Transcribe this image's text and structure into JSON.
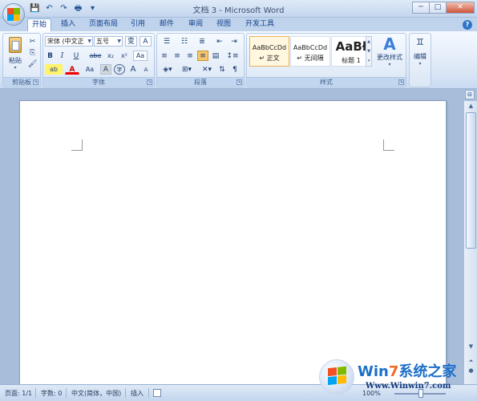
{
  "window": {
    "title": "文档 3 - Microsoft Word",
    "controls": {
      "minimize": "─",
      "maximize": "□",
      "close": "✕"
    }
  },
  "qat": {
    "save": "💾",
    "undo": "↶",
    "redo": "↷",
    "print": "🖶",
    "customize": "▾"
  },
  "tabs": [
    "开始",
    "插入",
    "页面布局",
    "引用",
    "邮件",
    "审阅",
    "视图",
    "开发工具"
  ],
  "active_tab": "开始",
  "help": "?",
  "ribbon": {
    "clipboard": {
      "label": "剪贴板",
      "paste": "粘贴",
      "cut": "✂",
      "copy": "⎘",
      "format_painter": "🖌"
    },
    "font": {
      "label": "字体",
      "font_name": "宋体 (中文正",
      "font_size": "五号",
      "wen": "变",
      "clear": "A",
      "bold": "B",
      "italic": "I",
      "underline": "U",
      "strikethrough": "abe",
      "subscript": "x₂",
      "superscript": "x²",
      "clear_format": "Aa",
      "highlight": "ab",
      "font_color": "A",
      "case": "Aa",
      "char_shading": "A",
      "enclose": "字",
      "grow": "A",
      "shrink": "A"
    },
    "paragraph": {
      "label": "段落"
    },
    "styles": {
      "label": "样式",
      "items": [
        {
          "preview": "AaBbCcDd",
          "name": "↵ 正文"
        },
        {
          "preview": "AaBbCcDd",
          "name": "↵ 无间隔"
        },
        {
          "preview": "AaBł",
          "name": "标题 1"
        }
      ],
      "change_styles": "更改样式"
    },
    "editing": {
      "label": "编辑"
    }
  },
  "status": {
    "page": "页面: 1/1",
    "words": "字数: 0",
    "language": "中文(简体，中国)",
    "mode": "插入",
    "zoom": "100%"
  },
  "watermark": {
    "brand_a": "Win",
    "brand_b": "7",
    "brand_c": "系统之家",
    "url": "Www.Winwin7.com"
  }
}
